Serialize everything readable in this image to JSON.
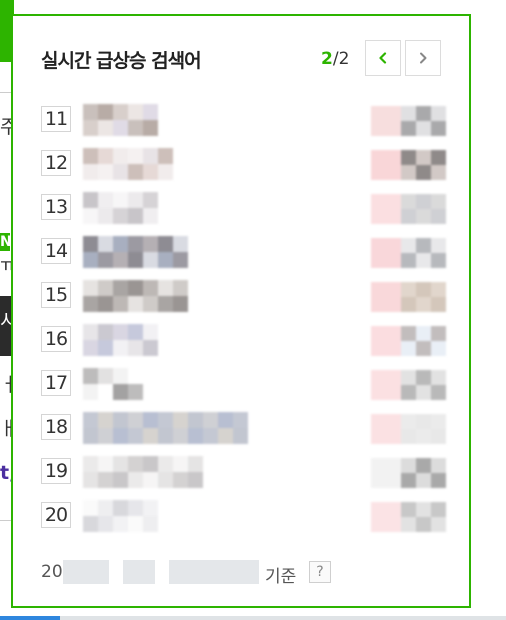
{
  "panel": {
    "title": "실시간 급상승 검색어",
    "page_current": "2",
    "page_total": "/2",
    "prev_icon": "chevron-left-icon",
    "next_icon": "chevron-right-icon",
    "accent": "#2db400"
  },
  "ranks": [
    {
      "rank": "11"
    },
    {
      "rank": "12"
    },
    {
      "rank": "13"
    },
    {
      "rank": "14"
    },
    {
      "rank": "15"
    },
    {
      "rank": "16"
    },
    {
      "rank": "17"
    },
    {
      "rank": "18"
    },
    {
      "rank": "19"
    },
    {
      "rank": "20"
    }
  ],
  "footer": {
    "date_prefix": "20",
    "basis_label": "기준",
    "help_label": "?"
  },
  "background_page": {
    "frag_1": "주",
    "frag_2": "N",
    "frag_3": "ㅠ",
    "frag_4": "시",
    "frag_5": "ㅓ",
    "frag_6": "ㅐ",
    "frag_7": "t,"
  }
}
